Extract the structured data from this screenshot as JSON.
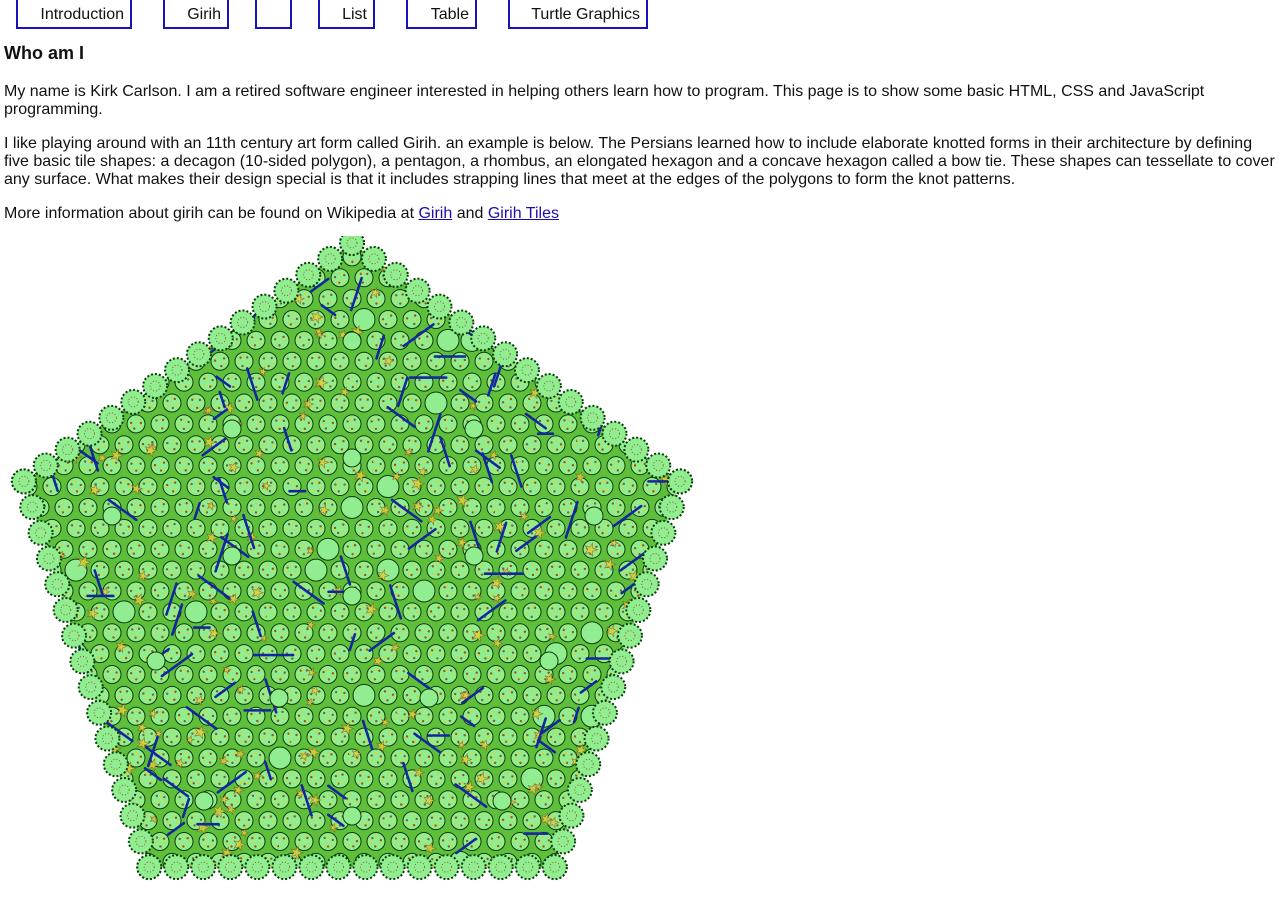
{
  "nav": {
    "items": [
      {
        "label": "Introduction"
      },
      {
        "label": "Girih"
      },
      {
        "label": ""
      },
      {
        "label": "List"
      },
      {
        "label": "Table"
      },
      {
        "label": "Turtle Graphics"
      }
    ]
  },
  "main": {
    "heading": "Who am I",
    "para1": "My name is Kirk Carlson. I am a retired software engineer interested in helping others learn how to program. This page is to show some basic HTML, CSS and JavaScript programming.",
    "para2": "I like playing around with an 11th century art form called Girih. an example is below. The Persians learned how to include elaborate knotted forms in their architecture by defining five basic tile shapes: a decagon (10-sided polygon), a pentagon, a rhombus, an elongated hexagon and a concave hexagon called a bow tie. These shapes can tessellate to cover any surface. What makes their design special is that it includes strapping lines that meet at the edges of the polygons to form the knot patterns.",
    "para3_prefix": "More information about girih can be found on Wikipedia at ",
    "link1": "Girih",
    "para3_middle": " and ",
    "link2": "Girih Tiles"
  },
  "colors": {
    "nav_border": "#1414b8",
    "link": "#1a0dab",
    "tile_green": "#5fbf3a",
    "tile_light": "#90ee90",
    "strap_blue": "#1226a0",
    "strap_dark": "#0b3b0b",
    "accent_yellow": "#d9d23a",
    "accent_brown": "#8a5a2a"
  }
}
